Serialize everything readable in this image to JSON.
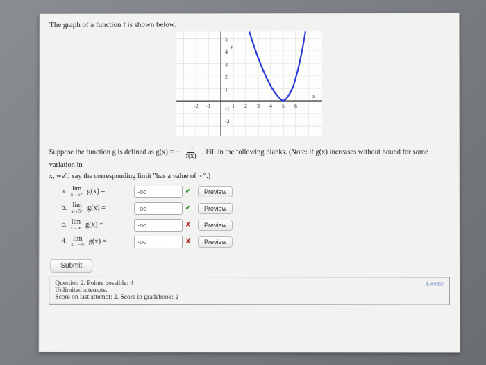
{
  "prompt_top": "The graph of a function f is shown below.",
  "suppose_pre": "Suppose the function g is defined as g(x) = −",
  "frac_num": "5",
  "frac_den": "f(x)",
  "suppose_post": ". Fill in the following blanks. (Note: if g(x) increases without bound for some variation in",
  "note_line": "x, we'll say the corresponding limit \"has a value of ∞\".)",
  "parts": {
    "a": {
      "letter": "a.",
      "lim": "lim",
      "sub": "x→5⁺",
      "fn": "g(x) =",
      "val": "-oo",
      "status": "correct"
    },
    "b": {
      "letter": "b.",
      "lim": "lim",
      "sub": "x→5⁻",
      "fn": "g(x) =",
      "val": "-oo",
      "status": "correct"
    },
    "c": {
      "letter": "c.",
      "lim": "lim",
      "sub": "x→∞",
      "fn": "g(x) =",
      "val": "-oo",
      "status": "wrong"
    },
    "d": {
      "letter": "d.",
      "lim": "lim",
      "sub": "x→−∞",
      "fn": "g(x) =",
      "val": "-oo",
      "status": "wrong"
    }
  },
  "preview_label": "Preview",
  "submit_label": "Submit",
  "score": {
    "l1": "Question 2. Points possible: 4",
    "l2": "Unlimited attempts.",
    "l3": "Score on last attempt: 2. Score in gradebook: 2"
  },
  "license": "License",
  "chart_data": {
    "type": "line",
    "title": "",
    "xlabel": "x",
    "ylabel": "y",
    "xlim": [
      -3,
      7
    ],
    "ylim": [
      -2.5,
      6
    ],
    "x_ticks": [
      -2,
      -1,
      1,
      2,
      3,
      4,
      5,
      6
    ],
    "y_ticks": [
      -2,
      -1,
      1,
      2,
      3,
      4,
      5
    ],
    "series": [
      {
        "name": "f",
        "color": "#2838d8",
        "points_left": [
          [
            2.3,
            6
          ],
          [
            2.8,
            4.5
          ],
          [
            3.3,
            2.8
          ],
          [
            3.8,
            1.5
          ],
          [
            4.3,
            0.6
          ],
          [
            4.7,
            0.15
          ],
          [
            5.0,
            0.0
          ]
        ],
        "points_right": [
          [
            5.0,
            0.0
          ],
          [
            5.3,
            0.15
          ],
          [
            5.7,
            0.7
          ],
          [
            6.1,
            1.8
          ],
          [
            6.4,
            3.3
          ],
          [
            6.7,
            5.2
          ],
          [
            6.9,
            6
          ]
        ],
        "note": "Function f has a minimum of 0 at x=5; rises without bound to left and right (parabola-like, steeper right branch)."
      }
    ]
  }
}
